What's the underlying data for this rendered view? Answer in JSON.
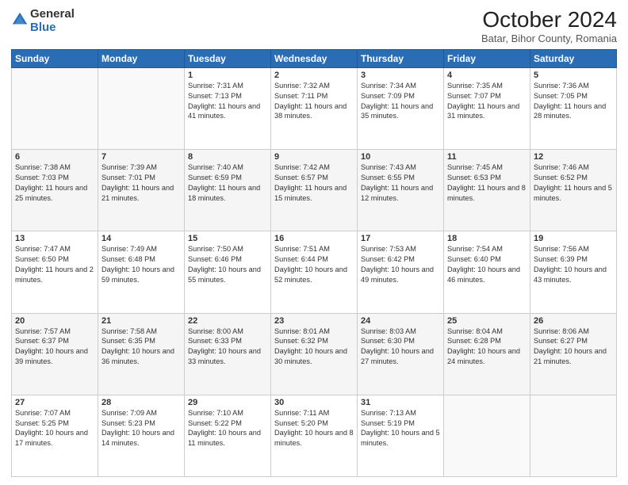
{
  "logo": {
    "general": "General",
    "blue": "Blue"
  },
  "title": "October 2024",
  "subtitle": "Batar, Bihor County, Romania",
  "days_header": [
    "Sunday",
    "Monday",
    "Tuesday",
    "Wednesday",
    "Thursday",
    "Friday",
    "Saturday"
  ],
  "weeks": [
    [
      {
        "num": "",
        "sunrise": "",
        "sunset": "",
        "daylight": ""
      },
      {
        "num": "",
        "sunrise": "",
        "sunset": "",
        "daylight": ""
      },
      {
        "num": "1",
        "sunrise": "Sunrise: 7:31 AM",
        "sunset": "Sunset: 7:13 PM",
        "daylight": "Daylight: 11 hours and 41 minutes."
      },
      {
        "num": "2",
        "sunrise": "Sunrise: 7:32 AM",
        "sunset": "Sunset: 7:11 PM",
        "daylight": "Daylight: 11 hours and 38 minutes."
      },
      {
        "num": "3",
        "sunrise": "Sunrise: 7:34 AM",
        "sunset": "Sunset: 7:09 PM",
        "daylight": "Daylight: 11 hours and 35 minutes."
      },
      {
        "num": "4",
        "sunrise": "Sunrise: 7:35 AM",
        "sunset": "Sunset: 7:07 PM",
        "daylight": "Daylight: 11 hours and 31 minutes."
      },
      {
        "num": "5",
        "sunrise": "Sunrise: 7:36 AM",
        "sunset": "Sunset: 7:05 PM",
        "daylight": "Daylight: 11 hours and 28 minutes."
      }
    ],
    [
      {
        "num": "6",
        "sunrise": "Sunrise: 7:38 AM",
        "sunset": "Sunset: 7:03 PM",
        "daylight": "Daylight: 11 hours and 25 minutes."
      },
      {
        "num": "7",
        "sunrise": "Sunrise: 7:39 AM",
        "sunset": "Sunset: 7:01 PM",
        "daylight": "Daylight: 11 hours and 21 minutes."
      },
      {
        "num": "8",
        "sunrise": "Sunrise: 7:40 AM",
        "sunset": "Sunset: 6:59 PM",
        "daylight": "Daylight: 11 hours and 18 minutes."
      },
      {
        "num": "9",
        "sunrise": "Sunrise: 7:42 AM",
        "sunset": "Sunset: 6:57 PM",
        "daylight": "Daylight: 11 hours and 15 minutes."
      },
      {
        "num": "10",
        "sunrise": "Sunrise: 7:43 AM",
        "sunset": "Sunset: 6:55 PM",
        "daylight": "Daylight: 11 hours and 12 minutes."
      },
      {
        "num": "11",
        "sunrise": "Sunrise: 7:45 AM",
        "sunset": "Sunset: 6:53 PM",
        "daylight": "Daylight: 11 hours and 8 minutes."
      },
      {
        "num": "12",
        "sunrise": "Sunrise: 7:46 AM",
        "sunset": "Sunset: 6:52 PM",
        "daylight": "Daylight: 11 hours and 5 minutes."
      }
    ],
    [
      {
        "num": "13",
        "sunrise": "Sunrise: 7:47 AM",
        "sunset": "Sunset: 6:50 PM",
        "daylight": "Daylight: 11 hours and 2 minutes."
      },
      {
        "num": "14",
        "sunrise": "Sunrise: 7:49 AM",
        "sunset": "Sunset: 6:48 PM",
        "daylight": "Daylight: 10 hours and 59 minutes."
      },
      {
        "num": "15",
        "sunrise": "Sunrise: 7:50 AM",
        "sunset": "Sunset: 6:46 PM",
        "daylight": "Daylight: 10 hours and 55 minutes."
      },
      {
        "num": "16",
        "sunrise": "Sunrise: 7:51 AM",
        "sunset": "Sunset: 6:44 PM",
        "daylight": "Daylight: 10 hours and 52 minutes."
      },
      {
        "num": "17",
        "sunrise": "Sunrise: 7:53 AM",
        "sunset": "Sunset: 6:42 PM",
        "daylight": "Daylight: 10 hours and 49 minutes."
      },
      {
        "num": "18",
        "sunrise": "Sunrise: 7:54 AM",
        "sunset": "Sunset: 6:40 PM",
        "daylight": "Daylight: 10 hours and 46 minutes."
      },
      {
        "num": "19",
        "sunrise": "Sunrise: 7:56 AM",
        "sunset": "Sunset: 6:39 PM",
        "daylight": "Daylight: 10 hours and 43 minutes."
      }
    ],
    [
      {
        "num": "20",
        "sunrise": "Sunrise: 7:57 AM",
        "sunset": "Sunset: 6:37 PM",
        "daylight": "Daylight: 10 hours and 39 minutes."
      },
      {
        "num": "21",
        "sunrise": "Sunrise: 7:58 AM",
        "sunset": "Sunset: 6:35 PM",
        "daylight": "Daylight: 10 hours and 36 minutes."
      },
      {
        "num": "22",
        "sunrise": "Sunrise: 8:00 AM",
        "sunset": "Sunset: 6:33 PM",
        "daylight": "Daylight: 10 hours and 33 minutes."
      },
      {
        "num": "23",
        "sunrise": "Sunrise: 8:01 AM",
        "sunset": "Sunset: 6:32 PM",
        "daylight": "Daylight: 10 hours and 30 minutes."
      },
      {
        "num": "24",
        "sunrise": "Sunrise: 8:03 AM",
        "sunset": "Sunset: 6:30 PM",
        "daylight": "Daylight: 10 hours and 27 minutes."
      },
      {
        "num": "25",
        "sunrise": "Sunrise: 8:04 AM",
        "sunset": "Sunset: 6:28 PM",
        "daylight": "Daylight: 10 hours and 24 minutes."
      },
      {
        "num": "26",
        "sunrise": "Sunrise: 8:06 AM",
        "sunset": "Sunset: 6:27 PM",
        "daylight": "Daylight: 10 hours and 21 minutes."
      }
    ],
    [
      {
        "num": "27",
        "sunrise": "Sunrise: 7:07 AM",
        "sunset": "Sunset: 5:25 PM",
        "daylight": "Daylight: 10 hours and 17 minutes."
      },
      {
        "num": "28",
        "sunrise": "Sunrise: 7:09 AM",
        "sunset": "Sunset: 5:23 PM",
        "daylight": "Daylight: 10 hours and 14 minutes."
      },
      {
        "num": "29",
        "sunrise": "Sunrise: 7:10 AM",
        "sunset": "Sunset: 5:22 PM",
        "daylight": "Daylight: 10 hours and 11 minutes."
      },
      {
        "num": "30",
        "sunrise": "Sunrise: 7:11 AM",
        "sunset": "Sunset: 5:20 PM",
        "daylight": "Daylight: 10 hours and 8 minutes."
      },
      {
        "num": "31",
        "sunrise": "Sunrise: 7:13 AM",
        "sunset": "Sunset: 5:19 PM",
        "daylight": "Daylight: 10 hours and 5 minutes."
      },
      {
        "num": "",
        "sunrise": "",
        "sunset": "",
        "daylight": ""
      },
      {
        "num": "",
        "sunrise": "",
        "sunset": "",
        "daylight": ""
      }
    ]
  ]
}
